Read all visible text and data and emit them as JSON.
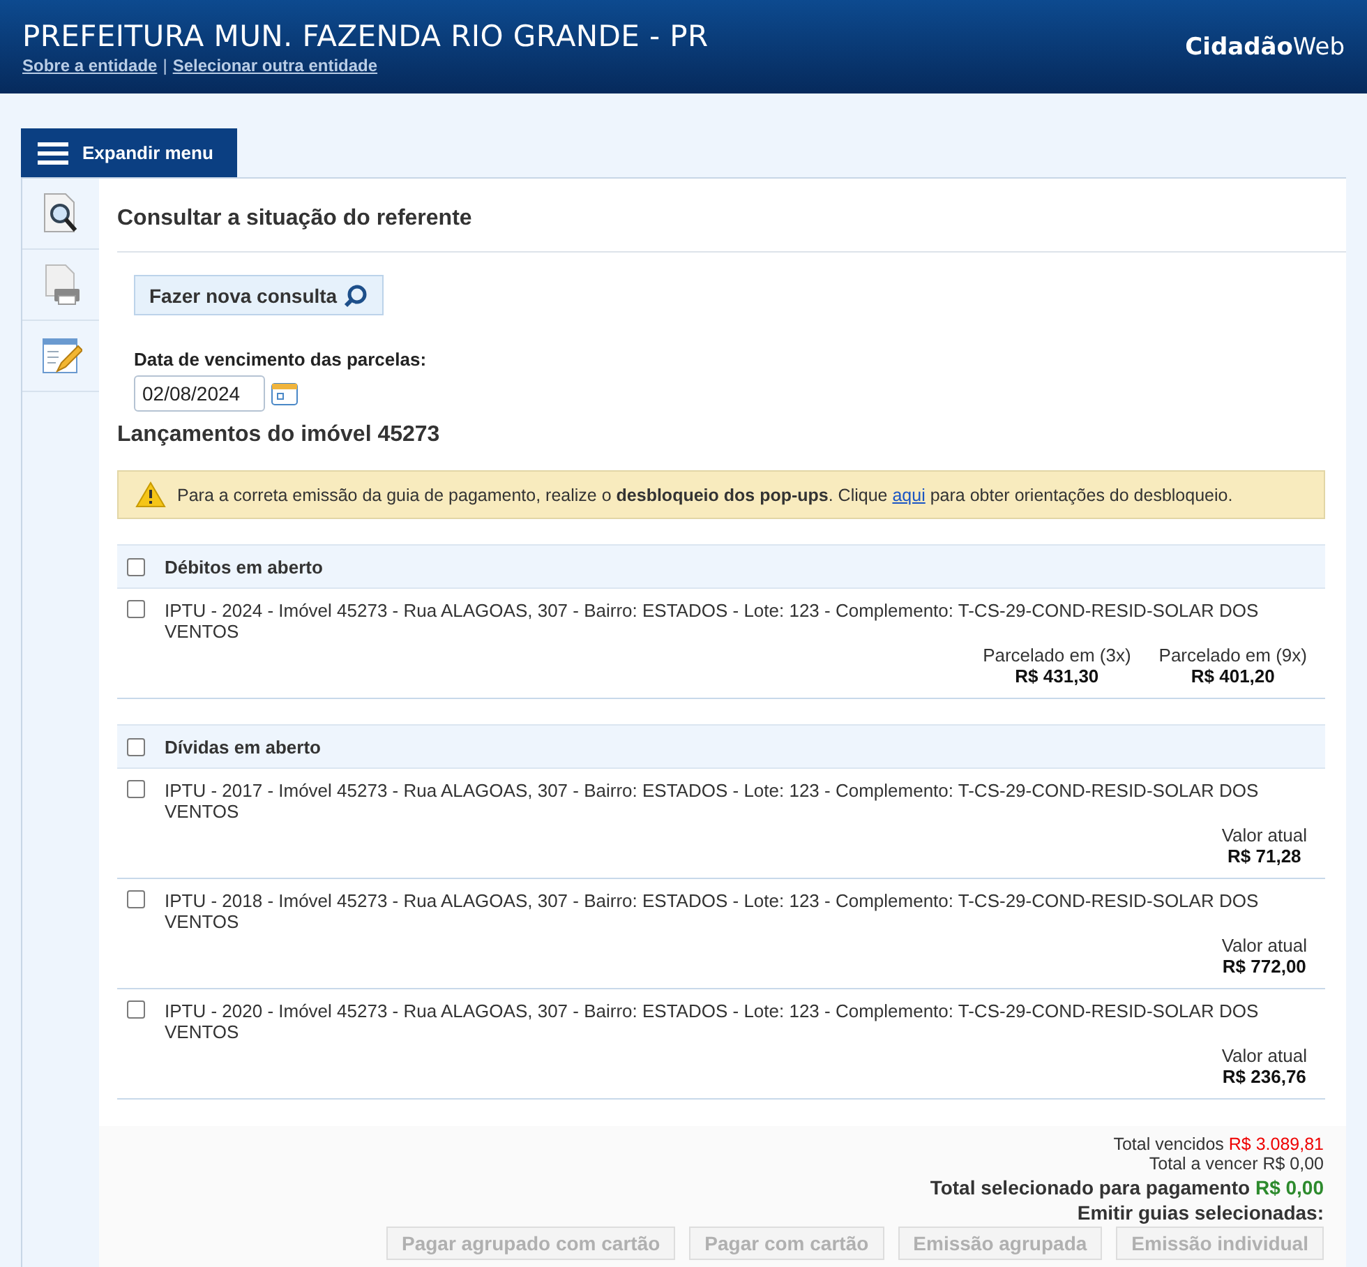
{
  "header": {
    "title": "PREFEITURA MUN. FAZENDA RIO GRANDE - PR",
    "links": [
      "Sobre a entidade",
      "Selecionar outra entidade"
    ],
    "separator": "|",
    "brand_bold": "Cidadão",
    "brand_light": "Web"
  },
  "menu_tab": {
    "label": "Expandir menu"
  },
  "page_title": "Consultar a situação do referente",
  "new_query_button": "Fazer nova consulta",
  "due_date": {
    "label": "Data de vencimento das parcelas:",
    "value": "02/08/2024"
  },
  "property_heading": "Lançamentos do imóvel 45273",
  "warning": {
    "text_before": "Para a correta emissão da guia de pagamento, realize o **desbloqueio dos pop-ups**. Clique",
    "link": "aqui",
    "text_after": "para obter orientações do desbloqueio."
  },
  "sections": [
    {
      "title": "Débitos em aberto",
      "checked": false,
      "items": [
        {
          "description": "IPTU - 2024 - Imóvel 45273 - Rua ALAGOAS, 307 - Bairro: ESTADOS - Lote: 123 - Complemento: T-CS-29-COND-RESID-SOLAR DOS VENTOS",
          "checked": false,
          "values": [
            {
              "label": "Parcelado em (3x)",
              "amount": "R$ 431,30"
            },
            {
              "label": "Parcelado em (9x)",
              "amount": "R$ 401,20"
            }
          ]
        }
      ]
    },
    {
      "title": "Dívidas em aberto",
      "checked": false,
      "items": [
        {
          "description": "IPTU - 2017 - Imóvel 45273 - Rua ALAGOAS, 307 - Bairro: ESTADOS - Lote: 123 - Complemento: T-CS-29-COND-RESID-SOLAR DOS VENTOS",
          "checked": false,
          "values": [
            {
              "label": "Valor atual",
              "amount": "R$ 71,28"
            }
          ]
        },
        {
          "description": "IPTU - 2018 - Imóvel 45273 - Rua ALAGOAS, 307 - Bairro: ESTADOS - Lote: 123 - Complemento: T-CS-29-COND-RESID-SOLAR DOS VENTOS",
          "checked": false,
          "values": [
            {
              "label": "Valor atual",
              "amount": "R$ 772,00"
            }
          ]
        },
        {
          "description": "IPTU - 2020 - Imóvel 45273 - Rua ALAGOAS, 307 - Bairro: ESTADOS - Lote: 123 - Complemento: T-CS-29-COND-RESID-SOLAR DOS VENTOS",
          "checked": false,
          "values": [
            {
              "label": "Valor atual",
              "amount": "R$ 236,76"
            }
          ]
        }
      ]
    }
  ],
  "totals": {
    "overdue_label": "Total vencidos",
    "overdue_value": "R$ 3.089,81",
    "upcoming": "Total a vencer R$ 0,00",
    "selected_label": "Total selecionado para pagamento",
    "selected_value": "R$ 0,00",
    "emit_label": "Emitir guias selecionadas:"
  },
  "actions": [
    {
      "label": "Pagar agrupado com cartão",
      "disabled": true
    },
    {
      "label": "Pagar com cartão",
      "disabled": true
    },
    {
      "label": "Emissão agrupada",
      "disabled": true
    },
    {
      "label": "Emissão individual",
      "disabled": true
    }
  ]
}
